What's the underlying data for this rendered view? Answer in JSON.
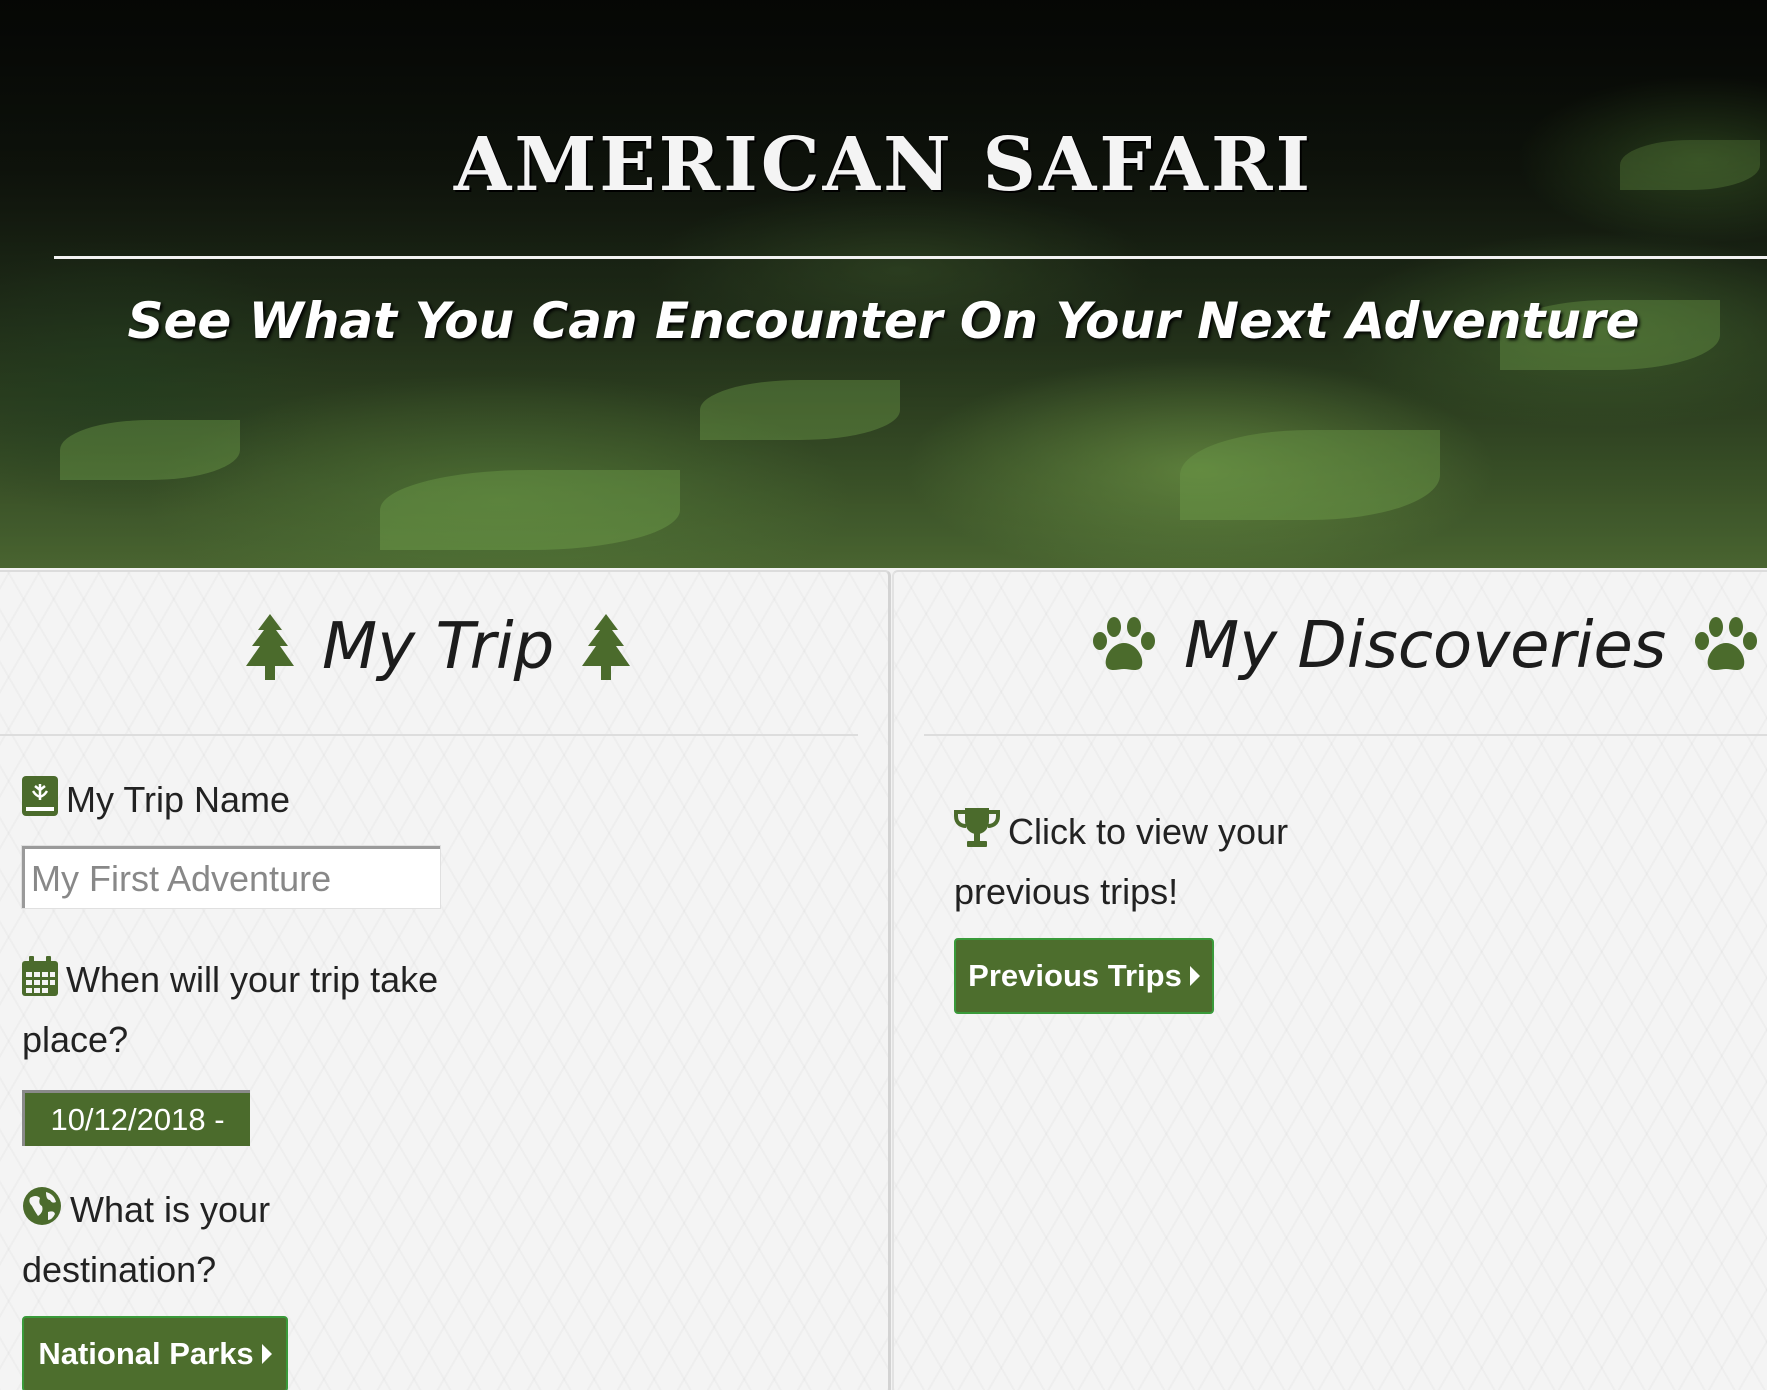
{
  "hero": {
    "title": "AMERICAN SAFARI",
    "subtitle": "See What You Can Encounter On Your Next Adventure"
  },
  "my_trip": {
    "heading": "My Trip",
    "heading_icon": "tree-icon",
    "trip_name": {
      "label": "My Trip Name",
      "icon": "book-icon",
      "placeholder": "My First Adventure"
    },
    "date": {
      "label": "When will your trip take place?",
      "icon": "calendar-icon",
      "value": "10/12/2018 -"
    },
    "destination": {
      "label": "What is your destination?",
      "icon": "globe-icon",
      "button_label": "National Parks"
    }
  },
  "my_discoveries": {
    "heading": "My Discoveries",
    "heading_icon": "paw-icon",
    "previous": {
      "label": "Click to view your previous trips!",
      "icon": "trophy-icon",
      "button_label": "Previous Trips"
    }
  },
  "colors": {
    "accent_green": "#4d6e2d",
    "icon_green": "#4b6b2c",
    "button_border": "#3a9a3a"
  }
}
